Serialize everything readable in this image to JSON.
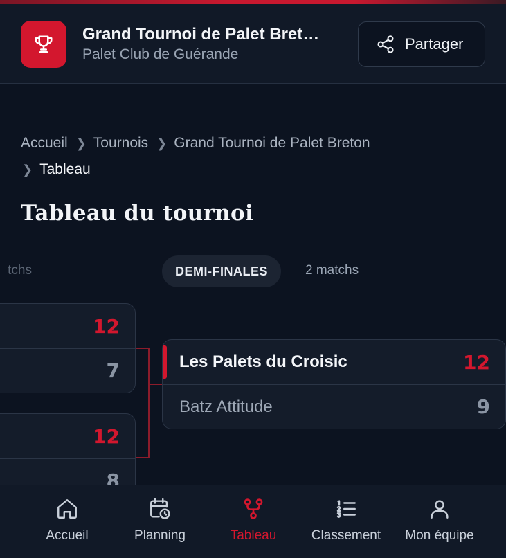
{
  "header": {
    "title": "Grand Tournoi de Palet Bret…",
    "subtitle": "Palet Club de Guérande",
    "share_label": "Partager",
    "brand_color": "#d3172e"
  },
  "breadcrumb": {
    "items": [
      "Accueil",
      "Tournois",
      "Grand Tournoi de Palet Breton"
    ],
    "current": "Tableau"
  },
  "page_title": "Tableau du tournoi",
  "bracket": {
    "previous_round_count_fragment": "tchs",
    "round_name": "DEMI-FINALES",
    "round_count": "2 matchs",
    "previous_round_matches": [
      {
        "scores": [
          "12",
          "7"
        ]
      },
      {
        "scores": [
          "12",
          "8"
        ]
      }
    ],
    "semifinal": {
      "team1": "Les Palets du Croisic",
      "score1": "12",
      "team2": "Batz Attitude",
      "score2": "9"
    }
  },
  "nav": {
    "items": [
      {
        "label": "Accueil",
        "icon": "home-icon"
      },
      {
        "label": "Planning",
        "icon": "calendar-clock-icon"
      },
      {
        "label": "Tableau",
        "icon": "bracket-icon",
        "active": true
      },
      {
        "label": "Classement",
        "icon": "ranking-list-icon"
      },
      {
        "label": "Mon équipe",
        "icon": "user-icon"
      }
    ]
  }
}
